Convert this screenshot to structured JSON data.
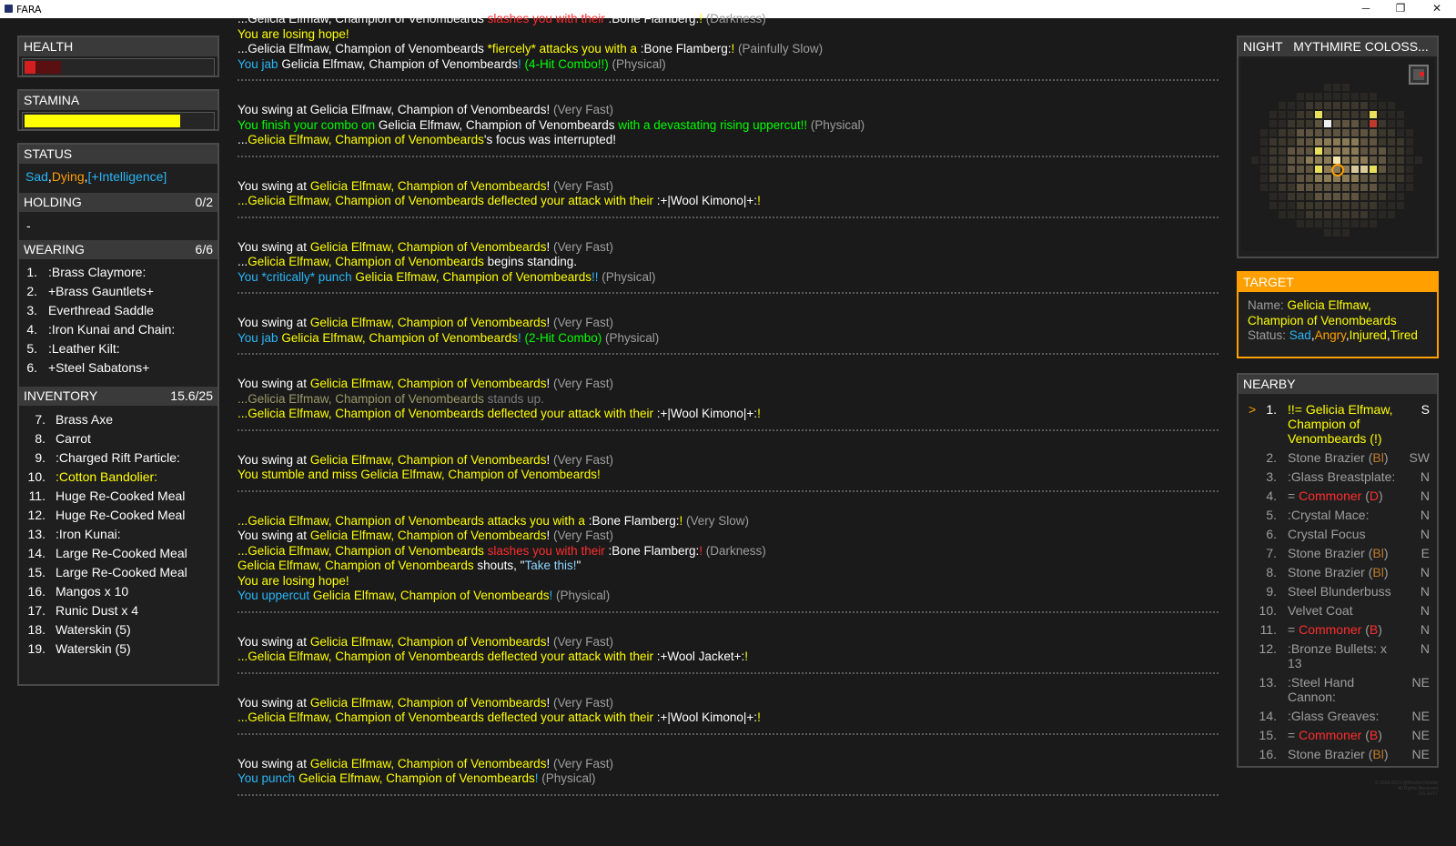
{
  "window": {
    "title": "FARA",
    "minimize": "─",
    "restore": "❐",
    "close": "✕"
  },
  "health": {
    "label": "HEALTH",
    "value_fraction": 0.06,
    "color": "#d31f1f"
  },
  "stamina": {
    "label": "STAMINA",
    "value_fraction": 0.83,
    "color": "#ffff00"
  },
  "status": {
    "label": "STATUS",
    "effects": [
      {
        "text": "Sad",
        "color": "#29b6f6"
      },
      {
        "text": ",",
        "color": "#ffffff"
      },
      {
        "text": "Dying",
        "color": "#ffa000"
      },
      {
        "text": ",",
        "color": "#ffffff"
      },
      {
        "text": "[+Intelligence]",
        "color": "#29b6f6"
      }
    ]
  },
  "holding": {
    "label": "HOLDING",
    "count": "0/2",
    "value": "-"
  },
  "wearing": {
    "label": "WEARING",
    "count": "6/6",
    "items": [
      {
        "n": "1.",
        "name": ":Brass Claymore:"
      },
      {
        "n": "2.",
        "name": "+Brass Gauntlets+"
      },
      {
        "n": "3.",
        "name": "Everthread Saddle"
      },
      {
        "n": "4.",
        "name": ":Iron Kunai and Chain:"
      },
      {
        "n": "5.",
        "name": ":Leather Kilt:"
      },
      {
        "n": "6.",
        "name": "+Steel Sabatons+"
      }
    ]
  },
  "inventory": {
    "label": "INVENTORY",
    "weight": "15.6/25",
    "items": [
      {
        "n": "7.",
        "name": "Brass Axe",
        "color": "#ffffff"
      },
      {
        "n": "8.",
        "name": "Carrot",
        "color": "#ffffff"
      },
      {
        "n": "9.",
        "name": ":Charged Rift Particle:",
        "color": "#ffffff"
      },
      {
        "n": "10.",
        "name": ":Cotton Bandolier:",
        "color": "#ffff00"
      },
      {
        "n": "11.",
        "name": "Huge Re-Cooked Meal",
        "color": "#ffffff"
      },
      {
        "n": "12.",
        "name": "Huge Re-Cooked Meal",
        "color": "#ffffff"
      },
      {
        "n": "13.",
        "name": ":Iron Kunai:",
        "color": "#ffffff"
      },
      {
        "n": "14.",
        "name": "Large Re-Cooked Meal",
        "color": "#ffffff"
      },
      {
        "n": "15.",
        "name": "Large Re-Cooked Meal",
        "color": "#ffffff"
      },
      {
        "n": "16.",
        "name": "Mangos x 10",
        "color": "#ffffff"
      },
      {
        "n": "17.",
        "name": "Runic Dust x 4",
        "color": "#ffffff"
      },
      {
        "n": "18.",
        "name": "Waterskin (5)",
        "color": "#ffffff"
      },
      {
        "n": "19.",
        "name": "Waterskin (5)",
        "color": "#ffffff"
      }
    ]
  },
  "log": {
    "groups": [
      [
        [
          {
            "t": "...Gelicia Elfmaw, Champion of Venombeards ",
            "c": "w"
          },
          {
            "t": "slashes you with their ",
            "c": "r"
          },
          {
            "t": ":Bone Flamberg:",
            "c": "w"
          },
          {
            "t": "! ",
            "c": "y"
          },
          {
            "t": "(Darkness)",
            "c": "g"
          }
        ],
        [
          {
            "t": "You are losing hope!",
            "c": "y"
          }
        ],
        [
          {
            "t": "...Gelicia Elfmaw, Champion of Venombeards ",
            "c": "w"
          },
          {
            "t": "*fiercely* attacks you with a ",
            "c": "y"
          },
          {
            "t": ":Bone Flamberg:",
            "c": "w"
          },
          {
            "t": "! ",
            "c": "y"
          },
          {
            "t": "(Painfully Slow)",
            "c": "g"
          }
        ],
        [
          {
            "t": "You jab ",
            "c": "c"
          },
          {
            "t": "Gelicia Elfmaw, Champion of Venombeards",
            "c": "w"
          },
          {
            "t": "! ",
            "c": "c"
          },
          {
            "t": "(4-Hit Combo!!) ",
            "c": "gr"
          },
          {
            "t": "(Physical)",
            "c": "g"
          }
        ]
      ],
      [
        [
          {
            "t": "You swing at Gelicia Elfmaw, Champion of Venombeards! ",
            "c": "w"
          },
          {
            "t": "(Very Fast)",
            "c": "g"
          }
        ],
        [
          {
            "t": "You finish your combo on ",
            "c": "gr"
          },
          {
            "t": "Gelicia Elfmaw, Champion of Venombeards ",
            "c": "w"
          },
          {
            "t": "with a devastating rising uppercut!! ",
            "c": "gr"
          },
          {
            "t": "(Physical)",
            "c": "g"
          }
        ],
        [
          {
            "t": "...",
            "c": "w"
          },
          {
            "t": "Gelicia Elfmaw, Champion of Venombeards",
            "c": "y"
          },
          {
            "t": "'s focus was interrupted!",
            "c": "w"
          }
        ]
      ],
      [
        [
          {
            "t": "You swing at ",
            "c": "w"
          },
          {
            "t": "Gelicia Elfmaw, Champion of Venombeards",
            "c": "y"
          },
          {
            "t": "! ",
            "c": "w"
          },
          {
            "t": "(Very Fast)",
            "c": "g"
          }
        ],
        [
          {
            "t": "...Gelicia Elfmaw, Champion of Venombeards deflected your attack with their ",
            "c": "y"
          },
          {
            "t": ":+|Wool Kimono|+:",
            "c": "w"
          },
          {
            "t": "!",
            "c": "y"
          }
        ]
      ],
      [
        [
          {
            "t": "You swing at ",
            "c": "w"
          },
          {
            "t": "Gelicia Elfmaw, Champion of Venombeards",
            "c": "y"
          },
          {
            "t": "! ",
            "c": "w"
          },
          {
            "t": "(Very Fast)",
            "c": "g"
          }
        ],
        [
          {
            "t": "...",
            "c": "w"
          },
          {
            "t": "Gelicia Elfmaw, Champion of Venombeards ",
            "c": "y"
          },
          {
            "t": "begins standing.",
            "c": "w"
          }
        ],
        [
          {
            "t": "You *critically* punch ",
            "c": "c"
          },
          {
            "t": "Gelicia Elfmaw, Champion of Venombeards",
            "c": "y"
          },
          {
            "t": "!! ",
            "c": "c"
          },
          {
            "t": "(Physical)",
            "c": "g"
          }
        ]
      ],
      [
        [
          {
            "t": "You swing at ",
            "c": "w"
          },
          {
            "t": "Gelicia Elfmaw, Champion of Venombeards",
            "c": "y"
          },
          {
            "t": "! ",
            "c": "w"
          },
          {
            "t": "(Very Fast)",
            "c": "g"
          }
        ],
        [
          {
            "t": "You jab ",
            "c": "c"
          },
          {
            "t": "Gelicia Elfmaw, Champion of Venombeards",
            "c": "y"
          },
          {
            "t": "! ",
            "c": "c"
          },
          {
            "t": "(2-Hit Combo) ",
            "c": "gr"
          },
          {
            "t": "(Physical)",
            "c": "g"
          }
        ]
      ],
      [
        [
          {
            "t": "You swing at ",
            "c": "w"
          },
          {
            "t": "Gelicia Elfmaw, Champion of Venombeards",
            "c": "y"
          },
          {
            "t": "! ",
            "c": "w"
          },
          {
            "t": "(Very Fast)",
            "c": "g"
          }
        ],
        [
          {
            "t": "...Gelicia Elfmaw, Champion of Venombeards ",
            "c": "dy"
          },
          {
            "t": "stands up.",
            "c": "dg"
          }
        ],
        [
          {
            "t": "...Gelicia Elfmaw, Champion of Venombeards deflected your attack with their ",
            "c": "y"
          },
          {
            "t": ":+|Wool Kimono|+:",
            "c": "w"
          },
          {
            "t": "!",
            "c": "y"
          }
        ]
      ],
      [
        [
          {
            "t": "You swing at ",
            "c": "w"
          },
          {
            "t": "Gelicia Elfmaw, Champion of Venombeards",
            "c": "y"
          },
          {
            "t": "! ",
            "c": "w"
          },
          {
            "t": "(Very Fast)",
            "c": "g"
          }
        ],
        [
          {
            "t": "You stumble and miss Gelicia Elfmaw, Champion of Venombeards!",
            "c": "y"
          }
        ]
      ],
      [
        [
          {
            "t": "...Gelicia Elfmaw, Champion of Venombeards attacks you with a ",
            "c": "y"
          },
          {
            "t": ":Bone Flamberg:",
            "c": "w"
          },
          {
            "t": "! ",
            "c": "y"
          },
          {
            "t": "(Very Slow)",
            "c": "g"
          }
        ],
        [
          {
            "t": "You swing at ",
            "c": "w"
          },
          {
            "t": "Gelicia Elfmaw, Champion of Venombeards",
            "c": "y"
          },
          {
            "t": "! ",
            "c": "w"
          },
          {
            "t": "(Very Fast)",
            "c": "g"
          }
        ],
        [
          {
            "t": "...Gelicia Elfmaw, Champion of Venombeards ",
            "c": "y"
          },
          {
            "t": "slashes you with their ",
            "c": "r"
          },
          {
            "t": ":Bone Flamberg:",
            "c": "w"
          },
          {
            "t": "! ",
            "c": "r"
          },
          {
            "t": "(Darkness)",
            "c": "g"
          }
        ],
        [
          {
            "t": "Gelicia Elfmaw, Champion of Venombeards ",
            "c": "y"
          },
          {
            "t": "shouts, \"",
            "c": "w"
          },
          {
            "t": "Take this!",
            "c": "lb"
          },
          {
            "t": "\"",
            "c": "w"
          }
        ],
        [
          {
            "t": "You are losing hope!",
            "c": "y"
          }
        ],
        [
          {
            "t": "You uppercut ",
            "c": "c"
          },
          {
            "t": "Gelicia Elfmaw, Champion of Venombeards",
            "c": "y"
          },
          {
            "t": "! ",
            "c": "c"
          },
          {
            "t": "(Physical)",
            "c": "g"
          }
        ]
      ],
      [
        [
          {
            "t": "You swing at ",
            "c": "w"
          },
          {
            "t": "Gelicia Elfmaw, Champion of Venombeards",
            "c": "y"
          },
          {
            "t": "! ",
            "c": "w"
          },
          {
            "t": "(Very Fast)",
            "c": "g"
          }
        ],
        [
          {
            "t": "...Gelicia Elfmaw, Champion of Venombeards deflected your attack with their ",
            "c": "y"
          },
          {
            "t": ":+Wool Jacket+:",
            "c": "w"
          },
          {
            "t": "!",
            "c": "y"
          }
        ]
      ],
      [
        [
          {
            "t": "You swing at ",
            "c": "w"
          },
          {
            "t": "Gelicia Elfmaw, Champion of Venombeards",
            "c": "y"
          },
          {
            "t": "! ",
            "c": "w"
          },
          {
            "t": "(Very Fast)",
            "c": "g"
          }
        ],
        [
          {
            "t": "...Gelicia Elfmaw, Champion of Venombeards deflected your attack with their ",
            "c": "y"
          },
          {
            "t": ":+|Wool Kimono|+:",
            "c": "w"
          },
          {
            "t": "!",
            "c": "y"
          }
        ]
      ],
      [
        [
          {
            "t": "You swing at ",
            "c": "w"
          },
          {
            "t": "Gelicia Elfmaw, Champion of Venombeards",
            "c": "y"
          },
          {
            "t": "! ",
            "c": "w"
          },
          {
            "t": "(Very Fast)",
            "c": "g"
          }
        ],
        [
          {
            "t": "You punch ",
            "c": "c"
          },
          {
            "t": "Gelicia Elfmaw, Champion of Venombeards",
            "c": "y"
          },
          {
            "t": "! ",
            "c": "c"
          },
          {
            "t": "(Physical)",
            "c": "g"
          }
        ]
      ]
    ]
  },
  "map": {
    "time": "NIGHT",
    "location": "MYTHMIRE COLOSS..."
  },
  "target": {
    "label": "TARGET",
    "name_label": "Name:",
    "name_line1": "Gelicia Elfmaw,",
    "name_line2": "Champion of Venombeards",
    "status_label": "Status:",
    "status": [
      {
        "text": "Sad",
        "color": "#29b6f6"
      },
      {
        "text": ",",
        "color": "#ffffff"
      },
      {
        "text": "Angry",
        "color": "#ffa000"
      },
      {
        "text": ",",
        "color": "#ffffff"
      },
      {
        "text": "Injured",
        "color": "#ffff00"
      },
      {
        "text": ",",
        "color": "#ffffff"
      },
      {
        "text": "Tired",
        "color": "#ffff00"
      }
    ],
    "accent": "#ffa000"
  },
  "nearby": {
    "label": "NEARBY",
    "items": [
      {
        "sel": ">",
        "n": "1.",
        "lines": [
          [
            {
              "t": "!!= Gelicia Elfmaw,",
              "c": "y"
            }
          ],
          [
            {
              "t": "Champion of",
              "c": "y"
            }
          ],
          [
            {
              "t": "Venombeards (!)",
              "c": "y"
            }
          ]
        ],
        "dir": "S",
        "active": true
      },
      {
        "n": "2.",
        "lines": [
          [
            {
              "t": "Stone Brazier ",
              "c": "g"
            },
            {
              "t": "(",
              "c": "g"
            },
            {
              "t": "Bl",
              "c": "br"
            },
            {
              "t": ")",
              "c": "g"
            }
          ]
        ],
        "dir": "SW"
      },
      {
        "n": "3.",
        "lines": [
          [
            {
              "t": ":Glass Breastplate:",
              "c": "g"
            }
          ]
        ],
        "dir": "N"
      },
      {
        "n": "4.",
        "lines": [
          [
            {
              "t": "= ",
              "c": "g"
            },
            {
              "t": "Commoner",
              "c": "r"
            },
            {
              "t": " (",
              "c": "g"
            },
            {
              "t": "D",
              "c": "r"
            },
            {
              "t": ")",
              "c": "g"
            }
          ]
        ],
        "dir": "N"
      },
      {
        "n": "5.",
        "lines": [
          [
            {
              "t": ":Crystal Mace:",
              "c": "g"
            }
          ]
        ],
        "dir": "N"
      },
      {
        "n": "6.",
        "lines": [
          [
            {
              "t": "Crystal Focus",
              "c": "g"
            }
          ]
        ],
        "dir": "N"
      },
      {
        "n": "7.",
        "lines": [
          [
            {
              "t": "Stone Brazier ",
              "c": "g"
            },
            {
              "t": "(",
              "c": "g"
            },
            {
              "t": "Bl",
              "c": "br"
            },
            {
              "t": ")",
              "c": "g"
            }
          ]
        ],
        "dir": "E"
      },
      {
        "n": "8.",
        "lines": [
          [
            {
              "t": "Stone Brazier ",
              "c": "g"
            },
            {
              "t": "(",
              "c": "g"
            },
            {
              "t": "Bl",
              "c": "br"
            },
            {
              "t": ")",
              "c": "g"
            }
          ]
        ],
        "dir": "N"
      },
      {
        "n": "9.",
        "lines": [
          [
            {
              "t": "Steel Blunderbuss",
              "c": "g"
            }
          ]
        ],
        "dir": "N"
      },
      {
        "n": "10.",
        "lines": [
          [
            {
              "t": "Velvet Coat",
              "c": "g"
            }
          ]
        ],
        "dir": "N"
      },
      {
        "n": "11.",
        "lines": [
          [
            {
              "t": "= ",
              "c": "g"
            },
            {
              "t": "Commoner",
              "c": "r"
            },
            {
              "t": " (",
              "c": "g"
            },
            {
              "t": "B",
              "c": "r"
            },
            {
              "t": ")",
              "c": "g"
            }
          ]
        ],
        "dir": "N"
      },
      {
        "n": "12.",
        "lines": [
          [
            {
              "t": ":Bronze Bullets: x",
              "c": "g"
            }
          ],
          [
            {
              "t": "13",
              "c": "g"
            }
          ]
        ],
        "dir": "N"
      },
      {
        "n": "13.",
        "lines": [
          [
            {
              "t": ":Steel Hand",
              "c": "g"
            }
          ],
          [
            {
              "t": "Cannon:",
              "c": "g"
            }
          ]
        ],
        "dir": "NE"
      },
      {
        "n": "14.",
        "lines": [
          [
            {
              "t": ":Glass Greaves:",
              "c": "g"
            }
          ]
        ],
        "dir": "NE"
      },
      {
        "n": "15.",
        "lines": [
          [
            {
              "t": "= ",
              "c": "g"
            },
            {
              "t": "Commoner",
              "c": "r"
            },
            {
              "t": " (",
              "c": "g"
            },
            {
              "t": "B",
              "c": "r"
            },
            {
              "t": ")",
              "c": "g"
            }
          ]
        ],
        "dir": "NE"
      },
      {
        "n": "16.",
        "lines": [
          [
            {
              "t": "Stone Brazier ",
              "c": "g"
            },
            {
              "t": "(",
              "c": "g"
            },
            {
              "t": "Bl",
              "c": "br"
            },
            {
              "t": ")",
              "c": "g"
            }
          ]
        ],
        "dir": "NE"
      }
    ]
  },
  "copyright": {
    "line1": "© 2018-2019 @MonitorOwlette",
    "line2": "All Rights Reserved",
    "line3": "0.6.14.57"
  }
}
